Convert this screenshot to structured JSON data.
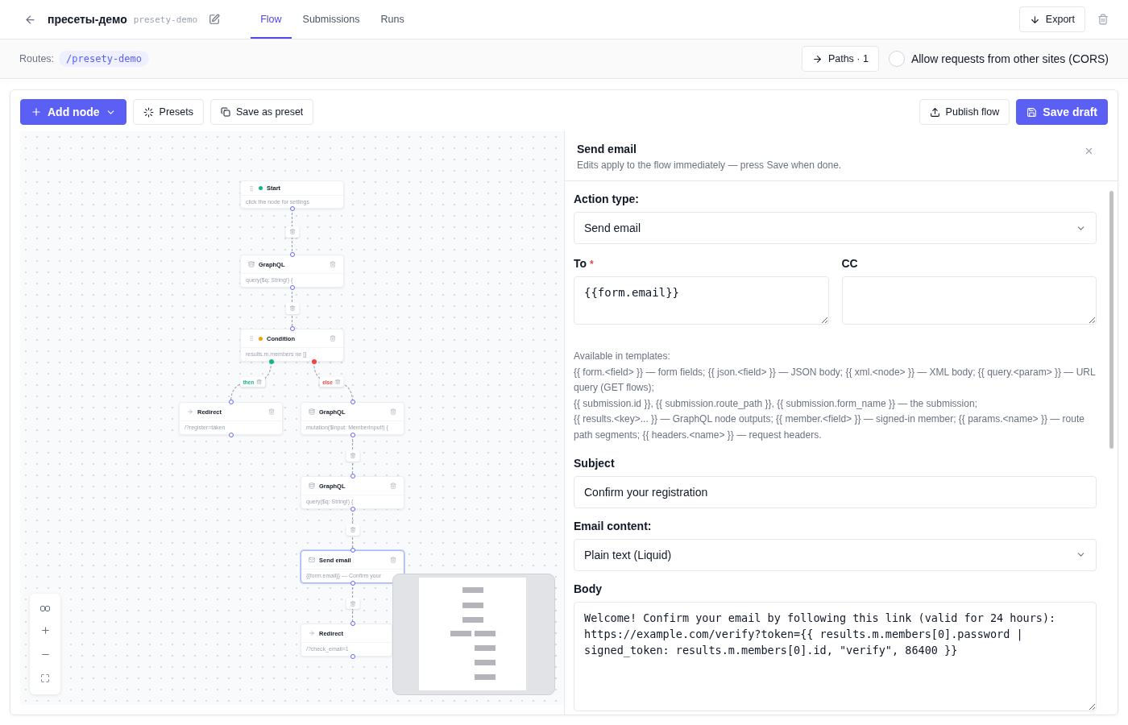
{
  "header": {
    "title": "пресеты-демо",
    "slug": "presety-demo",
    "tabs": [
      {
        "label": "Flow",
        "selected": true
      },
      {
        "label": "Submissions",
        "selected": false
      },
      {
        "label": "Runs",
        "selected": false
      }
    ],
    "export": "Export"
  },
  "routes": {
    "label": "Routes:",
    "route": "/presety-demo",
    "paths": "Paths · 1",
    "cors": {
      "label": "Allow requests from other sites (CORS)",
      "checked": false
    }
  },
  "toolbar": {
    "add_node": "Add node",
    "presets": "Presets",
    "save_preset": "Save as preset",
    "publish": "Publish flow",
    "save_draft": "Save draft"
  },
  "flow": {
    "nodes": [
      {
        "kind": "start",
        "title": "Start",
        "subtitle": "click the node for settings",
        "color": "#10b981",
        "deletable": false,
        "selected": false
      },
      {
        "kind": "graphql",
        "title": "GraphQL",
        "subtitle": "query($q: String!) {",
        "deletable": true,
        "selected": false
      },
      {
        "kind": "condition",
        "title": "Condition",
        "subtitle": "results.m.members ne []",
        "color": "#f59e0b",
        "deletable": true,
        "selected": false,
        "branches": [
          {
            "label": "then",
            "color": "#10b981"
          },
          {
            "label": "else",
            "color": "#ef4444"
          }
        ]
      },
      {
        "kind": "redirect",
        "title": "Redirect",
        "subtitle": "/?register=taken",
        "deletable": true,
        "selected": false
      },
      {
        "kind": "graphql",
        "title": "GraphQL",
        "subtitle": "mutation($input: MemberInput!) {",
        "deletable": true,
        "selected": false
      },
      {
        "kind": "graphql",
        "title": "GraphQL",
        "subtitle": "query($q: String!) {",
        "deletable": true,
        "selected": false
      },
      {
        "kind": "email",
        "title": "Send email",
        "subtitle": "{{form.email}} — Confirm your",
        "deletable": true,
        "selected": true
      },
      {
        "kind": "redirect",
        "title": "Redirect",
        "subtitle": "/?check_email=1",
        "deletable": false,
        "selected": false
      }
    ]
  },
  "panel": {
    "title": "Send email",
    "subtitle": "Edits apply to the flow immediately — press Save when done.",
    "action_type": {
      "label": "Action type:",
      "value": "Send email"
    },
    "to": {
      "label": "To",
      "required_mark": "*",
      "value": "{{form.email}}"
    },
    "cc": {
      "label": "CC"
    },
    "help": [
      "Available in templates:",
      "{{ form.<field> }} — form fields; {{ json.<field> }} — JSON body; {{ xml.<node> }} — XML body; {{ query.<param> }} — URL query (GET flows);",
      "{{ submission.id }}, {{ submission.route_path }}, {{ submission.form_name }} — the submission;",
      "{{ results.<key>... }} — GraphQL node outputs; {{ member.<field> }} — signed-in member; {{ params.<name> }} — route path segments; {{ headers.<name> }} — request headers."
    ],
    "subject": {
      "label": "Subject",
      "value": "Confirm your registration"
    },
    "email_content": {
      "label": "Email content:",
      "value": "Plain text (Liquid)"
    },
    "body": {
      "label": "Body",
      "value": "Welcome! Confirm your email by following this link (valid for 24 hours):\nhttps://example.com/verify?token={{ results.m.members[0].password |\nsigned_token: results.m.members[0].id, \"verify\", 86400 }}"
    }
  }
}
